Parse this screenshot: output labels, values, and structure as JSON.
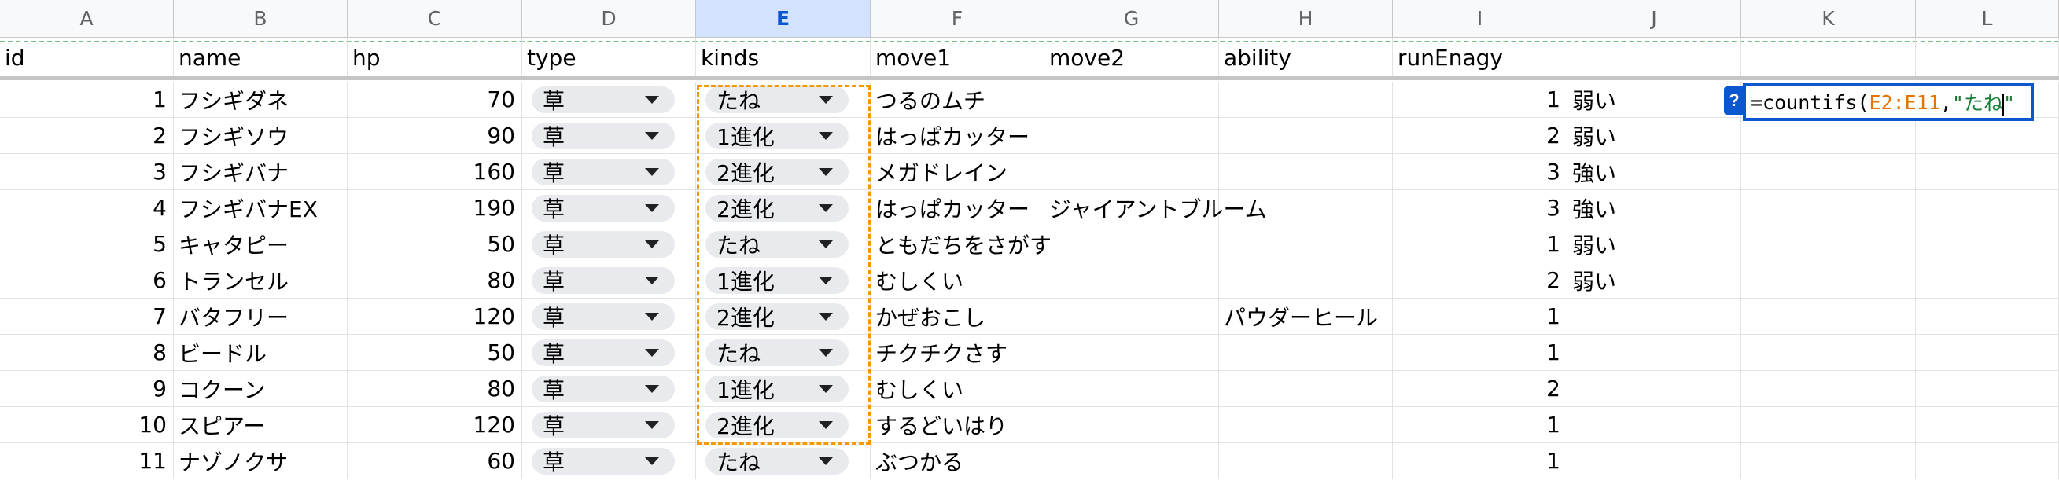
{
  "columns": [
    "A",
    "B",
    "C",
    "D",
    "E",
    "F",
    "G",
    "H",
    "I",
    "J",
    "K",
    "L"
  ],
  "selected_column": "E",
  "headers": [
    "id",
    "name",
    "hp",
    "type",
    "kinds",
    "move1",
    "move2",
    "ability",
    "runEnagy",
    "",
    "",
    ""
  ],
  "rows": [
    [
      "1",
      "フシギダネ",
      "70",
      "草",
      "たね",
      "つるのムチ",
      "",
      "",
      "1",
      "弱い"
    ],
    [
      "2",
      "フシギソウ",
      "90",
      "草",
      "1進化",
      "はっぱカッター",
      "",
      "",
      "2",
      "弱い"
    ],
    [
      "3",
      "フシギバナ",
      "160",
      "草",
      "2進化",
      "メガドレイン",
      "",
      "",
      "3",
      "強い"
    ],
    [
      "4",
      "フシギバナEX",
      "190",
      "草",
      "2進化",
      "はっぱカッター",
      "ジャイアントブルーム",
      "",
      "3",
      "強い"
    ],
    [
      "5",
      "キャタピー",
      "50",
      "草",
      "たね",
      "ともだちをさがす",
      "",
      "",
      "1",
      "弱い"
    ],
    [
      "6",
      "トランセル",
      "80",
      "草",
      "1進化",
      "むしくい",
      "",
      "",
      "2",
      "弱い"
    ],
    [
      "7",
      "バタフリー",
      "120",
      "草",
      "2進化",
      "かぜおこし",
      "",
      "パウダーヒール",
      "1",
      ""
    ],
    [
      "8",
      "ビードル",
      "50",
      "草",
      "たね",
      "チクチクさす",
      "",
      "",
      "1",
      ""
    ],
    [
      "9",
      "コクーン",
      "80",
      "草",
      "1進化",
      "むしくい",
      "",
      "",
      "2",
      ""
    ],
    [
      "10",
      "スピアー",
      "120",
      "草",
      "2進化",
      "するどいはり",
      "",
      "",
      "1",
      ""
    ],
    [
      "11",
      "ナゾノクサ",
      "60",
      "草",
      "たね",
      "ぶつかる",
      "",
      "",
      "1",
      ""
    ]
  ],
  "formula_editor": {
    "help_label": "?",
    "prefix": "=countifs(",
    "range_ref": "E2:E11",
    "separator": ",",
    "string_arg": "\"たね\""
  }
}
